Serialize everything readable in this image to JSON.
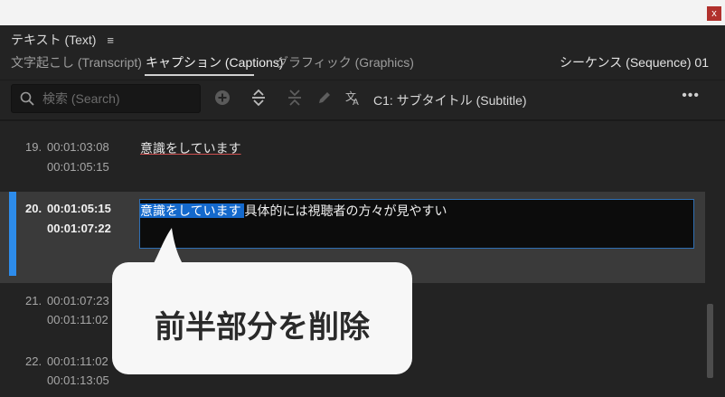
{
  "window": {
    "close_label": "x"
  },
  "panel": {
    "title": "テキスト (Text)",
    "menu_icon": "≡"
  },
  "tabs": [
    {
      "label": "文字起こし (Transcript)",
      "active": false
    },
    {
      "label": "キャプション (Captions)",
      "active": true
    },
    {
      "label": "グラフィック (Graphics)",
      "active": false
    }
  ],
  "sequence": "シーケンス (Sequence) 01",
  "search": {
    "placeholder": "検索 (Search)",
    "value": ""
  },
  "toolbar": {
    "track": "C1: サブタイトル (Subtitle)",
    "more": "•••",
    "icons": [
      "add-icon",
      "merge-icon",
      "split-icon",
      "pencil-icon",
      "translate-icon"
    ]
  },
  "captions": [
    {
      "num": "19.",
      "start": "00:01:03:08",
      "end": "00:01:05:15",
      "text": "意識をしています"
    },
    {
      "num": "20.",
      "start": "00:01:05:15",
      "end": "00:01:07:22",
      "text_selected": "意識をしています ",
      "text_rest": "具体的には視聴者の方々が見やすい"
    },
    {
      "num": "21.",
      "start": "00:01:07:23",
      "end": "00:01:11:02",
      "text": ""
    },
    {
      "num": "22.",
      "start": "00:01:11:02",
      "end": "00:01:13:05",
      "text": ""
    }
  ],
  "callout": {
    "text": "前半部分を削除"
  },
  "colors": {
    "accent": "#2d8ceb",
    "selection": "#1469cc",
    "background": "#232323"
  }
}
